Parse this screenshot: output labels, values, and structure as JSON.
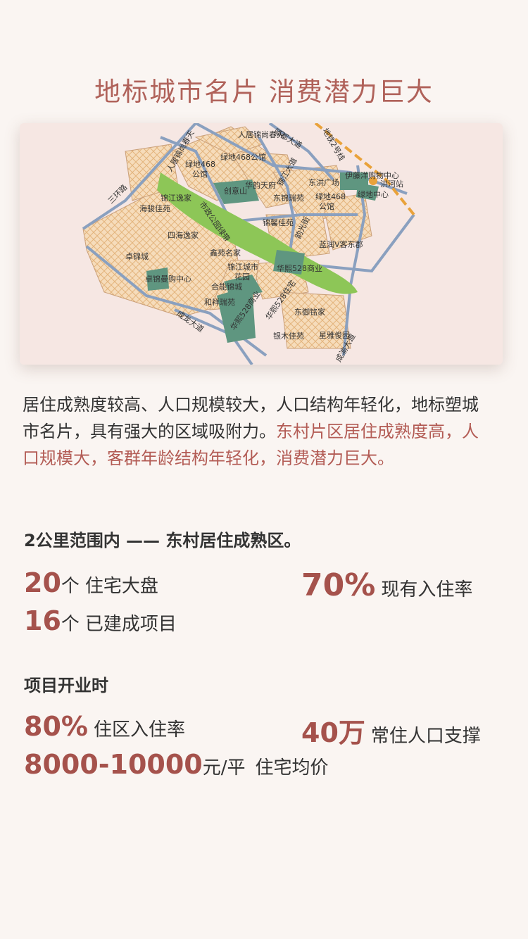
{
  "title": "地标城市名片  消费潜力巨大",
  "map": {
    "labels": {
      "renmin_jinshang_chuntian": "人居锦尚春天",
      "lvdi468_gongguan_top": "绿地468公馆",
      "lvdi468_gongguan_left": "绿地468",
      "lvdi468_gongguan_left2": "公馆",
      "renju_jinshang_left": "人居锦尚春天",
      "sanhuanlu": "三环路",
      "haijun_jiayuan": "海骏佳苑",
      "jinjiang_yijia": "锦江逸家",
      "shizheng_park": "市政公园绿带",
      "chuangyishan": "创意山",
      "huayun_tianfu": "华韵天府",
      "donghong_guangchang": "东洪广场",
      "jinjiang_dadao": "锦江大道",
      "dongjin_ruiyuan": "东锦瑞苑",
      "lvdi468_gongguan_right": "绿地468",
      "lvdi468_gongguan_right2": "公馆",
      "yiteng_yang": "伊藤洋购物中心",
      "lvdi_zhongxin": "绿地中心",
      "hongdao": "洪河站",
      "guanyun_jie": "韵光街",
      "sihai_yijia": "四海逸家",
      "xinyuan_mingjia": "鑫苑名家",
      "jinxiu_jiayuan": "锦馨佳苑",
      "lanrun_v": "蓝润V客东郡",
      "zhuojin_cheng": "卓锦城",
      "jinjiang_chengshi": "锦江城市",
      "jinjiang_chengshi2": "花园",
      "huaxi528_shangye": "华熙528商业",
      "zhuojin_mall": "卓锦曼购中心",
      "heneng_jincheng": "合能锦城",
      "heneng_ruiyuan": "和祥瑞苑",
      "huaxi528_shangye_2": "华熙528商业",
      "huaxi528_zhuzhai": "华熙528住宅",
      "dongyu_mingjia": "东御铭家",
      "yinmu_jiayuan": "银木佳苑",
      "xingya_junyuan": "星雅俊园",
      "chenglong_dadao": "成龙大道",
      "yiyuan_dadao": "驿都大道",
      "metro_line2": "地铁2号线",
      "chengyu_dadao": "成渝大道"
    },
    "colors": {
      "block_fill": "#f5d6b0",
      "block_hatch": "#e4b884",
      "road": "#8aa0bf",
      "green": "#8dc657",
      "teal": "#5f9680",
      "metro": "#e9a23a",
      "background": "#f6e7e3"
    }
  },
  "intro": {
    "normal": "居住成熟度较高、人口规模较大，人口结构年轻化，地标塑城市名片，具有强大的区域吸附力。",
    "highlight": "东村片区居住成熟度高，人口规模大，客群年龄结构年轻化，消费潜力巨大。"
  },
  "section1": {
    "title": "2公里范围内 —— 东村居住成熟区。",
    "stats": [
      {
        "num": "20",
        "unit": "个",
        "label": "住宅大盘"
      },
      {
        "num": "70%",
        "unit": "",
        "label": "现有入住率"
      },
      {
        "num": "16",
        "unit": "个",
        "label": "已建成项目"
      }
    ]
  },
  "section2": {
    "title": "项目开业时",
    "stats": [
      {
        "num": "80%",
        "unit": "",
        "label": "住区入住率"
      },
      {
        "num": "40万",
        "unit": "",
        "label": "常住人口支撑"
      },
      {
        "num": "8000-10000",
        "unit": "元/平",
        "label": "住宅均价"
      }
    ]
  }
}
